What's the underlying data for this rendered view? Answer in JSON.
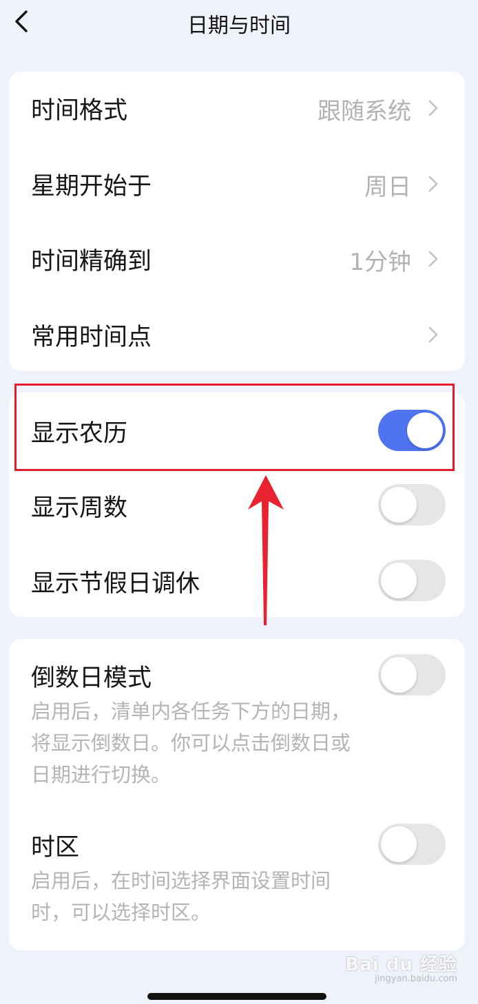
{
  "nav": {
    "title": "日期与时间",
    "back_icon": "chevron-left-icon"
  },
  "group1": {
    "items": [
      {
        "label": "时间格式",
        "value": "跟随系统"
      },
      {
        "label": "星期开始于",
        "value": "周日"
      },
      {
        "label": "时间精确到",
        "value": "1分钟"
      },
      {
        "label": "常用时间点",
        "value": ""
      }
    ]
  },
  "group2": {
    "items": [
      {
        "label": "显示农历",
        "on": true
      },
      {
        "label": "显示周数",
        "on": false
      },
      {
        "label": "显示节假日调休",
        "on": false
      }
    ]
  },
  "group3": {
    "items": [
      {
        "label": "倒数日模式",
        "description": "启用后，清单内各任务下方的日期，将显示倒数日。你可以点击倒数日或日期进行切换。",
        "on": false
      },
      {
        "label": "时区",
        "description": "启用后，在时间选择界面设置时间时，可以选择时区。",
        "on": false
      }
    ]
  },
  "watermark": {
    "text": "Bai du 经验",
    "sub": "jingyan.baidu.com"
  },
  "colors": {
    "accent": "#4f73f1",
    "annotation": "#e21c2a",
    "background": "#eff2fb"
  }
}
